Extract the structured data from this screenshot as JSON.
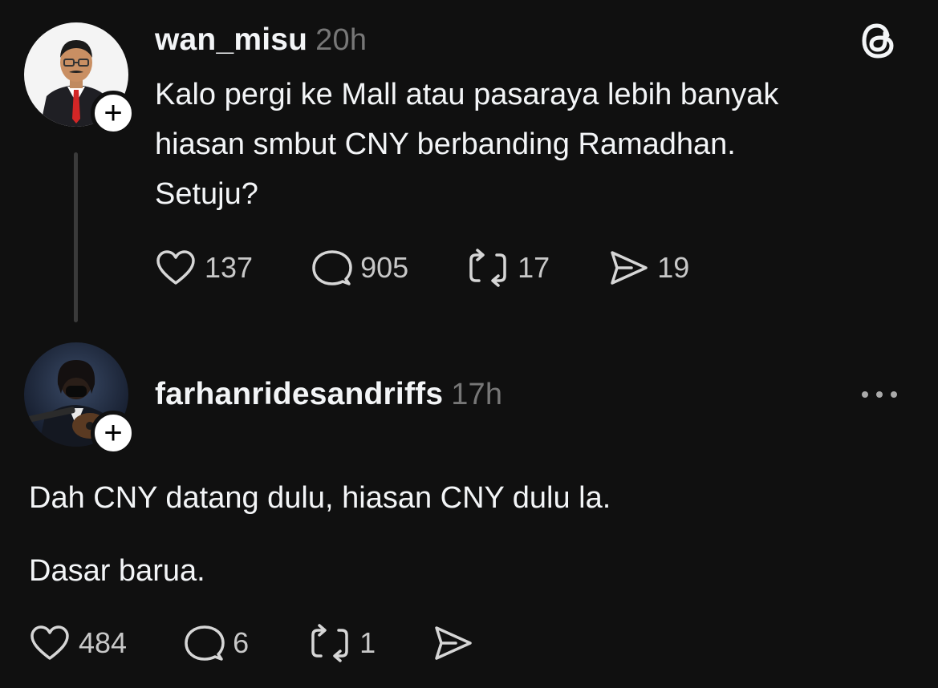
{
  "post": {
    "username": "wan_misu",
    "time": "20h",
    "text": "Kalo pergi ke Mall atau pasaraya lebih banyak\nhiasan smbut CNY berbanding Ramadhan.\nSetuju?",
    "likes": "137",
    "replies": "905",
    "reposts": "17",
    "shares": "19"
  },
  "reply": {
    "username": "farhanridesandriffs",
    "time": "17h",
    "paragraph1": "Dah CNY datang dulu, hiasan CNY dulu la.",
    "paragraph2": "Dasar barua.",
    "likes": "484",
    "replies": "6",
    "reposts": "1"
  },
  "icons": {
    "like": "heart-icon",
    "reply": "comment-bubble-icon",
    "repost": "repost-icon",
    "share": "send-icon",
    "brand": "threads-logo-icon",
    "more": "more-dots-icon",
    "follow": "plus-icon"
  },
  "colors": {
    "background": "#101010",
    "text": "#f3f5f7",
    "muted": "#777777"
  },
  "follow_symbol": "+"
}
